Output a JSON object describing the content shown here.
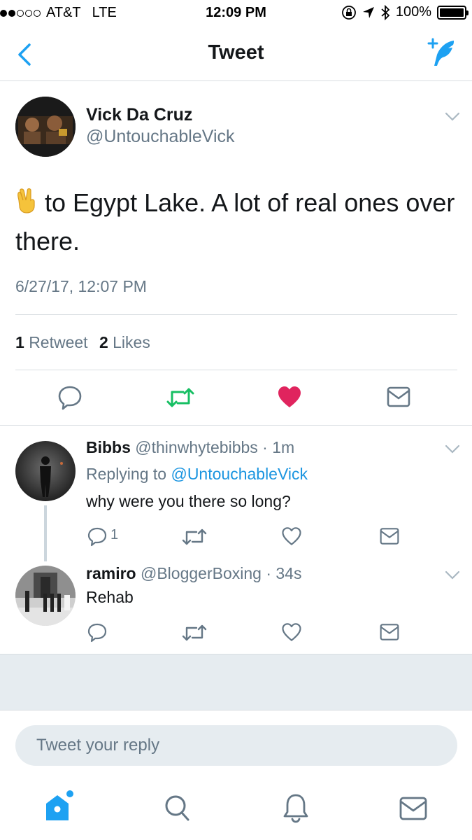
{
  "status_bar": {
    "carrier": "AT&T",
    "network": "LTE",
    "time": "12:09 PM",
    "battery": "100%"
  },
  "nav": {
    "title": "Tweet",
    "back_icon": "chevron-left-icon",
    "compose_icon": "compose-tweet-icon"
  },
  "tweet": {
    "author_name": "Vick Da Cruz",
    "author_handle": "@UntouchableVick",
    "emoji": "victory-hand-emoji",
    "text": "to Egypt Lake. A lot of real ones over there.",
    "timestamp": "6/27/17, 12:07 PM",
    "retweets_count": "1",
    "retweets_label": "Retweet",
    "likes_count": "2",
    "likes_label": "Likes",
    "liked": true
  },
  "replies": [
    {
      "name": "Bibbs",
      "handle": "@thinwhytebibbs",
      "time": "1m",
      "replying_prefix": "Replying to",
      "replying_to": "@UntouchableVick",
      "text": "why were you there so long?",
      "reply_count": "1"
    },
    {
      "name": "ramiro",
      "handle": "@BloggerBoxing",
      "time": "34s",
      "text": "Rehab",
      "reply_count": ""
    }
  ],
  "composer": {
    "placeholder": "Tweet your reply"
  },
  "tab_bar": [
    "home-icon",
    "search-icon",
    "notifications-icon",
    "messages-icon"
  ],
  "colors": {
    "accent": "#1da1f2",
    "like": "#e0245e",
    "retweet_active": "#17bf63",
    "muted": "#657786"
  }
}
